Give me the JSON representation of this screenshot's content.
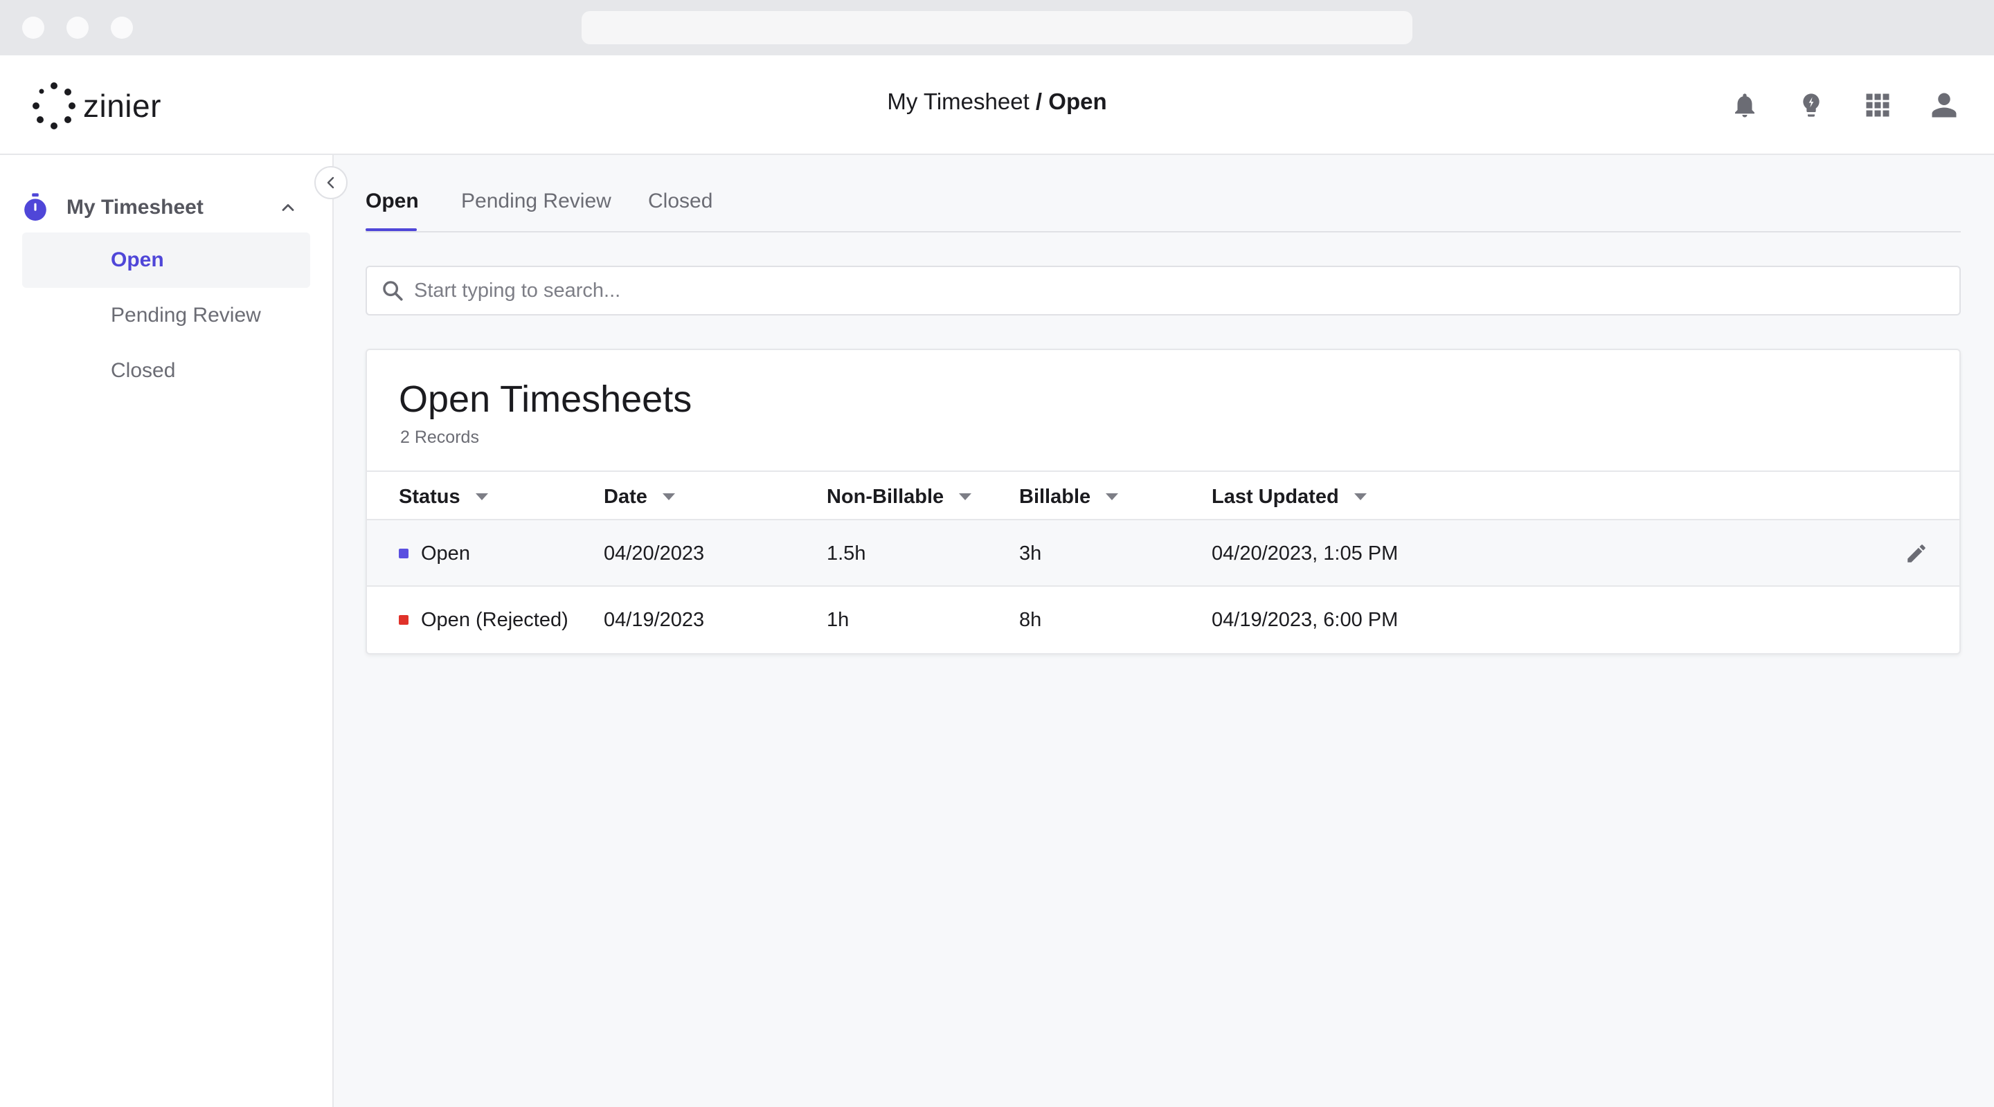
{
  "app": {
    "brand": "zinier",
    "breadcrumb": {
      "parent": "My Timesheet",
      "separator": " / ",
      "current": "Open"
    },
    "accent_color": "#4f46d8"
  },
  "header_icons": [
    "bell-icon",
    "lightbulb-icon",
    "apps-grid-icon",
    "user-icon"
  ],
  "sidebar": {
    "section_label": "My Timesheet",
    "section_icon": "stopwatch-icon",
    "items": [
      {
        "label": "Open",
        "active": true
      },
      {
        "label": "Pending Review",
        "active": false
      },
      {
        "label": "Closed",
        "active": false
      }
    ]
  },
  "tabs": [
    {
      "label": "Open",
      "active": true
    },
    {
      "label": "Pending Review",
      "active": false
    },
    {
      "label": "Closed",
      "active": false
    }
  ],
  "search": {
    "placeholder": "Start typing to search...",
    "value": ""
  },
  "table": {
    "title": "Open Timesheets",
    "record_count": "2 Records",
    "columns": [
      "Status",
      "Date",
      "Non-Billable",
      "Billable",
      "Last Updated"
    ],
    "rows": [
      {
        "status": "Open",
        "status_color": "#5b50e0",
        "date": "04/20/2023",
        "non_billable": "1.5h",
        "billable": "3h",
        "last_updated": "04/20/2023, 1:05 PM",
        "editable": true
      },
      {
        "status": "Open (Rejected)",
        "status_color": "#e0322a",
        "date": "04/19/2023",
        "non_billable": "1h",
        "billable": "8h",
        "last_updated": "04/19/2023, 6:00 PM",
        "editable": false
      }
    ]
  }
}
